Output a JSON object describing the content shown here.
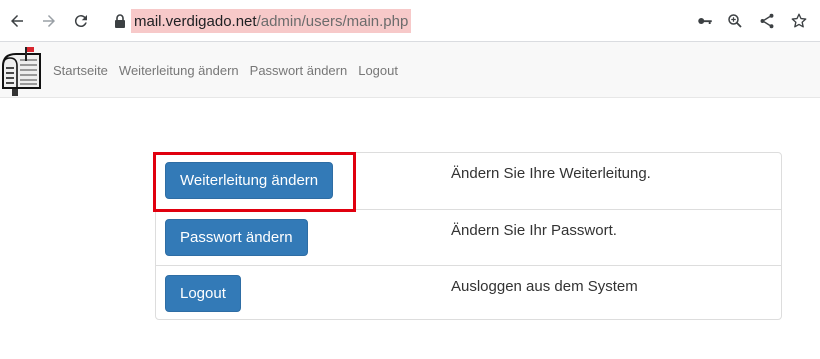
{
  "browser": {
    "url_host": "mail.verdigado.net",
    "url_path": "/admin/users/main.php"
  },
  "navbar": {
    "items": [
      {
        "label": "Startseite"
      },
      {
        "label": "Weiterleitung ändern"
      },
      {
        "label": "Passwort ändern"
      },
      {
        "label": "Logout"
      }
    ]
  },
  "actions": [
    {
      "button": "Weiterleitung ändern",
      "description": "Ändern Sie Ihre Weiterleitung."
    },
    {
      "button": "Passwort ändern",
      "description": "Ändern Sie Ihr Passwort."
    },
    {
      "button": "Logout",
      "description": "Ausloggen aus dem System"
    }
  ],
  "colors": {
    "primary_button": "#337ab7",
    "highlight_border": "#e0000f",
    "url_highlight": "#f7c9c9"
  },
  "icons": [
    "back-icon",
    "forward-icon",
    "reload-icon",
    "lock-icon",
    "key-icon",
    "zoom-icon",
    "share-icon",
    "star-icon",
    "mailbox-logo"
  ]
}
